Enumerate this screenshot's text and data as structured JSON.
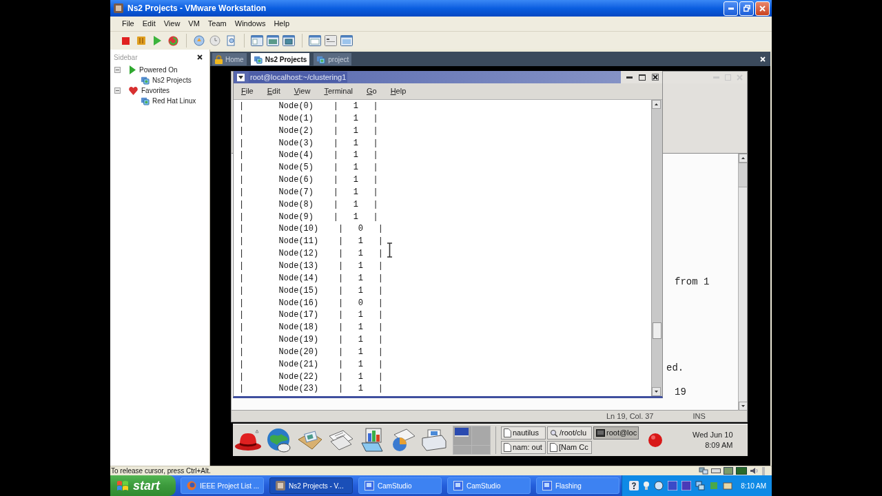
{
  "window": {
    "title": "Ns2 Projects - VMware Workstation"
  },
  "menu": [
    "File",
    "Edit",
    "View",
    "VM",
    "Team",
    "Windows",
    "Help"
  ],
  "sidebar": {
    "title": "Sidebar",
    "tree": [
      {
        "label": "Powered On",
        "kind": "running",
        "expanded": true,
        "children": [
          {
            "label": "Ns2 Projects",
            "kind": "vm"
          }
        ]
      },
      {
        "label": "Favorites",
        "kind": "favorites",
        "expanded": true,
        "children": [
          {
            "label": "Red Hat Linux",
            "kind": "vm"
          }
        ]
      }
    ]
  },
  "tabs": [
    {
      "label": "Home",
      "kind": "home",
      "selected": false
    },
    {
      "label": "Ns2 Projects",
      "kind": "vm",
      "selected": true
    },
    {
      "label": "project",
      "kind": "vm",
      "selected": false
    }
  ],
  "guest": {
    "editor_window": {
      "text_fragments": [
        "from 1",
        "ed.",
        "19"
      ],
      "status": {
        "position": "Ln 19, Col. 37",
        "mode": "INS"
      }
    },
    "terminal": {
      "title": "root@localhost:~/clustering1",
      "menu": [
        "File",
        "Edit",
        "View",
        "Terminal",
        "Go",
        "Help"
      ],
      "lines": [
        "|       Node(0)    |   1   |",
        "|       Node(1)    |   1   |",
        "|       Node(2)    |   1   |",
        "|       Node(3)    |   1   |",
        "|       Node(4)    |   1   |",
        "|       Node(5)    |   1   |",
        "|       Node(6)    |   1   |",
        "|       Node(7)    |   1   |",
        "|       Node(8)    |   1   |",
        "|       Node(9)    |   1   |",
        "|       Node(10)    |   0   |",
        "|       Node(11)    |   1   |",
        "|       Node(12)    |   1   |",
        "|       Node(13)    |   1   |",
        "|       Node(14)    |   1   |",
        "|       Node(15)    |   1   |",
        "|       Node(16)    |   0   |",
        "|       Node(17)    |   1   |",
        "|       Node(18)    |   1   |",
        "|       Node(19)    |   1   |",
        "|       Node(20)    |   1   |",
        "|       Node(21)    |   1   |",
        "|       Node(22)    |   1   |",
        "|       Node(23)    |   1   |"
      ]
    },
    "panel": {
      "workspaces": [
        {
          "selected": true
        },
        {
          "selected": false
        },
        {
          "selected": false
        },
        {
          "selected": false
        }
      ],
      "tasks": [
        {
          "label": "nautilus",
          "kind": "window",
          "selected": false
        },
        {
          "label": "/root/clu",
          "kind": "search",
          "selected": false
        },
        {
          "label": "root@loc",
          "kind": "terminal",
          "selected": true
        },
        {
          "label": "nam: out",
          "kind": "window",
          "selected": false
        },
        {
          "label": "[Nam Cc",
          "kind": "window",
          "selected": false
        }
      ],
      "clock": {
        "date": "Wed Jun 10",
        "time": "8:09 AM"
      }
    }
  },
  "status_bar": {
    "text": "To release cursor, press Ctrl+Alt."
  },
  "taskbar": {
    "start": "start",
    "tasks": [
      {
        "label": "IEEE Project List ...",
        "kind": "browser",
        "selected": false
      },
      {
        "label": "Ns2 Projects - V...",
        "kind": "vmware",
        "selected": true
      },
      {
        "label": "CamStudio",
        "kind": "app",
        "selected": false
      },
      {
        "label": "CamStudio",
        "kind": "app",
        "selected": false
      },
      {
        "label": "Flashing",
        "kind": "app",
        "selected": false
      }
    ],
    "time": "8:10 AM"
  }
}
